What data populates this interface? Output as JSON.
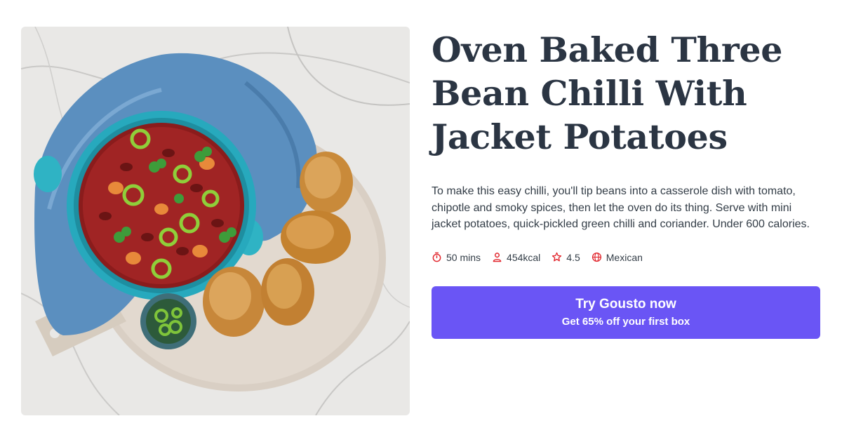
{
  "recipe": {
    "title": "Oven Baked Three Bean Chilli With Jacket Potatoes",
    "description": "To make this easy chilli, you'll tip beans into a casserole dish with tomato, chipotle and smoky spices, then let the oven do its thing. Serve with mini jacket potatoes, quick-pickled green chilli and coriander. Under 600 calories.",
    "meta": {
      "time": "50 mins",
      "calories": "454kcal",
      "rating": "4.5",
      "cuisine": "Mexican"
    }
  },
  "cta": {
    "primary_label": "Try Gousto now",
    "secondary_label": "Get 65% off your first box"
  },
  "icons": {
    "time": "timer-icon",
    "calories": "person-icon",
    "rating": "star-icon",
    "cuisine": "globe-icon"
  },
  "colors": {
    "accent": "#6a55f5",
    "icon": "#e1232a",
    "title": "#2b3543",
    "body_text": "#333d47"
  }
}
